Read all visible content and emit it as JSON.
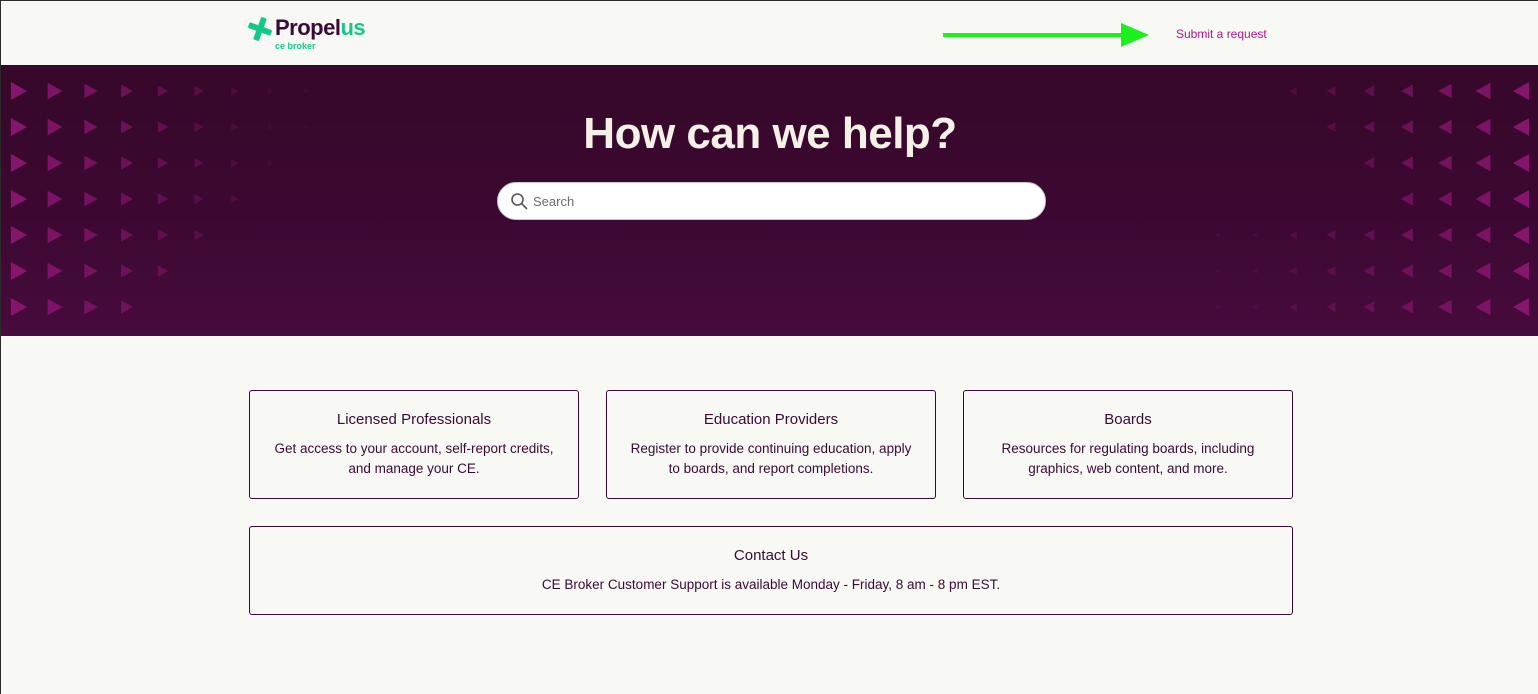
{
  "header": {
    "logo": {
      "brand_primary": "Propel",
      "brand_accent": "us",
      "subtitle": "ce broker"
    },
    "submit_request_label": "Submit a request"
  },
  "hero": {
    "title": "How can we help?",
    "search": {
      "placeholder": "Search",
      "value": ""
    }
  },
  "cards": [
    {
      "title": "Licensed Professionals",
      "description": "Get access to your account, self-report credits, and manage your CE."
    },
    {
      "title": "Education Providers",
      "description": "Register to provide continuing education, apply to boards, and report completions."
    },
    {
      "title": "Boards",
      "description": "Resources for regulating boards, including graphics, web content, and more."
    }
  ],
  "contact": {
    "title": "Contact Us",
    "description": "CE Broker Customer Support is available Monday - Friday, 8 am - 8 pm EST."
  },
  "icons": {
    "logo": "propelus-logo-icon",
    "search": "search-icon",
    "annotation": "arrow-right-icon"
  },
  "colors": {
    "brand_dark": "#3a0a35",
    "brand_green": "#14c88a",
    "link_magenta": "#b0168e",
    "hero_bg": "#3c0832",
    "pattern": "#8a1670",
    "annotation_arrow": "#1cf01c",
    "page_bg": "#f8f8f5"
  }
}
